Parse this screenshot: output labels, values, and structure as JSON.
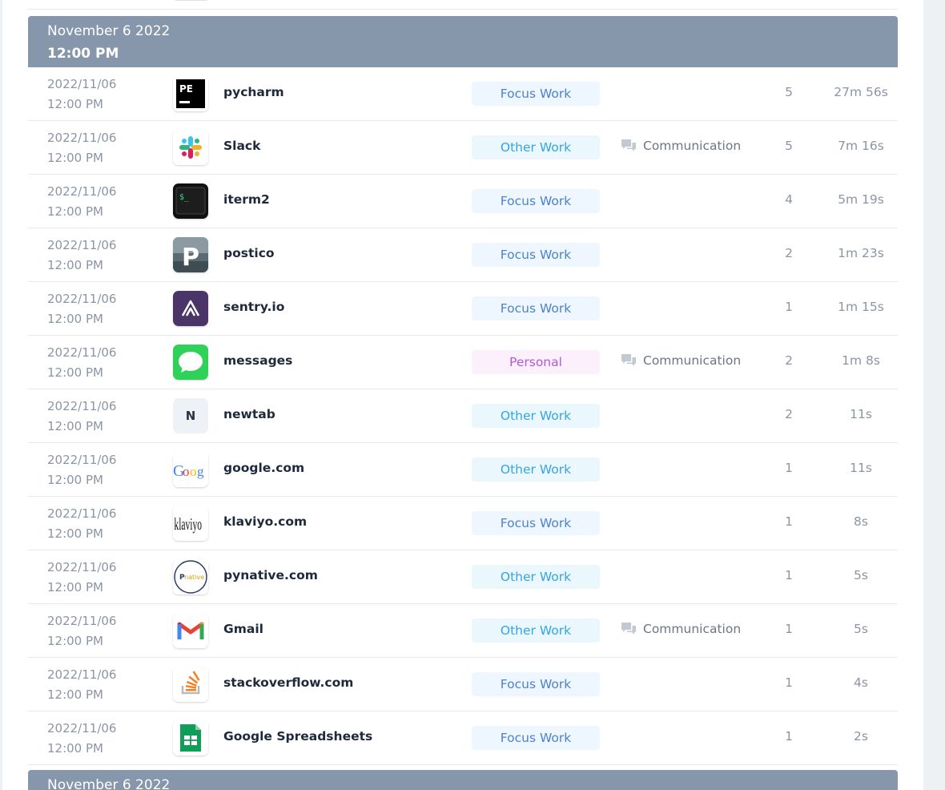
{
  "groups": [
    {
      "date": "November 6 2022",
      "time": "12:00 PM"
    },
    {
      "date": "November 6 2022"
    }
  ],
  "rows": [
    {
      "date": "2022/11/06",
      "time": "12:00 PM",
      "app": "pycharm",
      "icon": "pycharm-icon",
      "tag": "Focus Work",
      "tag_kind": "focus",
      "category": "",
      "count": "5",
      "duration": "27m 56s"
    },
    {
      "date": "2022/11/06",
      "time": "12:00 PM",
      "app": "Slack",
      "icon": "slack-icon",
      "tag": "Other Work",
      "tag_kind": "other",
      "category": "Communication",
      "count": "5",
      "duration": "7m 16s"
    },
    {
      "date": "2022/11/06",
      "time": "12:00 PM",
      "app": "iterm2",
      "icon": "iterm2-icon",
      "tag": "Focus Work",
      "tag_kind": "focus",
      "category": "",
      "count": "4",
      "duration": "5m 19s"
    },
    {
      "date": "2022/11/06",
      "time": "12:00 PM",
      "app": "postico",
      "icon": "postico-icon",
      "tag": "Focus Work",
      "tag_kind": "focus",
      "category": "",
      "count": "2",
      "duration": "1m 23s"
    },
    {
      "date": "2022/11/06",
      "time": "12:00 PM",
      "app": "sentry.io",
      "icon": "sentry-icon",
      "tag": "Focus Work",
      "tag_kind": "focus",
      "category": "",
      "count": "1",
      "duration": "1m 15s"
    },
    {
      "date": "2022/11/06",
      "time": "12:00 PM",
      "app": "messages",
      "icon": "messages-icon",
      "tag": "Personal",
      "tag_kind": "personal",
      "category": "Communication",
      "count": "2",
      "duration": "1m 8s"
    },
    {
      "date": "2022/11/06",
      "time": "12:00 PM",
      "app": "newtab",
      "icon": "newtab-icon",
      "icon_letter": "N",
      "tag": "Other Work",
      "tag_kind": "other",
      "category": "",
      "count": "2",
      "duration": "11s"
    },
    {
      "date": "2022/11/06",
      "time": "12:00 PM",
      "app": "google.com",
      "icon": "google-icon",
      "tag": "Other Work",
      "tag_kind": "other",
      "category": "",
      "count": "1",
      "duration": "11s"
    },
    {
      "date": "2022/11/06",
      "time": "12:00 PM",
      "app": "klaviyo.com",
      "icon": "klaviyo-icon",
      "tag": "Focus Work",
      "tag_kind": "focus",
      "category": "",
      "count": "1",
      "duration": "8s"
    },
    {
      "date": "2022/11/06",
      "time": "12:00 PM",
      "app": "pynative.com",
      "icon": "pynative-icon",
      "tag": "Other Work",
      "tag_kind": "other",
      "category": "",
      "count": "1",
      "duration": "5s"
    },
    {
      "date": "2022/11/06",
      "time": "12:00 PM",
      "app": "Gmail",
      "icon": "gmail-icon",
      "tag": "Other Work",
      "tag_kind": "other",
      "category": "Communication",
      "count": "1",
      "duration": "5s"
    },
    {
      "date": "2022/11/06",
      "time": "12:00 PM",
      "app": "stackoverflow.com",
      "icon": "stackoverflow-icon",
      "tag": "Focus Work",
      "tag_kind": "focus",
      "category": "",
      "count": "1",
      "duration": "4s"
    },
    {
      "date": "2022/11/06",
      "time": "12:00 PM",
      "app": "Google Spreadsheets",
      "icon": "google-sheets-icon",
      "tag": "Focus Work",
      "tag_kind": "focus",
      "category": "",
      "count": "1",
      "duration": "2s"
    }
  ]
}
